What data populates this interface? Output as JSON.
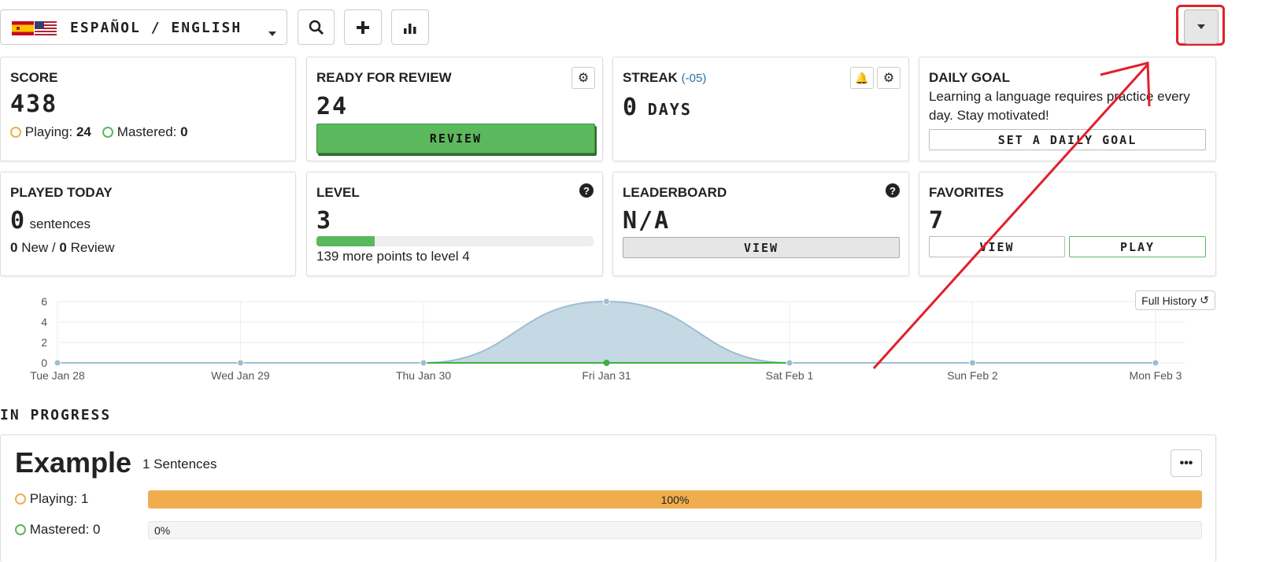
{
  "header": {
    "language_label": "ESPAÑOL / ENGLISH"
  },
  "score": {
    "title": "SCORE",
    "value": "438",
    "playing_label": "Playing:",
    "playing_value": "24",
    "mastered_label": "Mastered:",
    "mastered_value": "0"
  },
  "review": {
    "title": "READY FOR REVIEW",
    "value": "24",
    "button": "REVIEW"
  },
  "streak": {
    "title": "STREAK",
    "tz": "(-05)",
    "value": "0",
    "unit": "DAYS"
  },
  "daily_goal": {
    "title": "DAILY GOAL",
    "text": "Learning a language requires practice every day. Stay motivated!",
    "button": "SET A DAILY GOAL"
  },
  "played_today": {
    "title": "PLAYED TODAY",
    "value": "0",
    "unit": "sentences",
    "new_value": "0",
    "new_label": "New /",
    "review_value": "0",
    "review_label": "Review"
  },
  "level": {
    "title": "LEVEL",
    "value": "3",
    "progress": 0.21,
    "caption": "139 more points to level 4"
  },
  "leaderboard": {
    "title": "LEADERBOARD",
    "value": "N/A",
    "button": "VIEW"
  },
  "favorites": {
    "title": "FAVORITES",
    "value": "7",
    "view_button": "VIEW",
    "play_button": "PLAY"
  },
  "history": {
    "button": "Full History"
  },
  "chart_data": {
    "type": "area",
    "categories": [
      "Tue Jan 28",
      "Wed Jan 29",
      "Thu Jan 30",
      "Fri Jan 31",
      "Sat Feb 1",
      "Sun Feb 2",
      "Mon Feb 3"
    ],
    "series": [
      {
        "values": [
          0,
          0,
          0,
          6,
          0,
          0,
          0
        ],
        "color": "#9dbdd0"
      },
      {
        "values": [
          0,
          0,
          0,
          0,
          0,
          0,
          0
        ],
        "color": "#3cb043"
      }
    ],
    "yticks": [
      0,
      2,
      4,
      6
    ],
    "ylim": [
      0,
      6
    ]
  },
  "in_progress": {
    "heading": "IN PROGRESS",
    "name": "Example",
    "count": "1 Sentences",
    "playing_label": "Playing: 1",
    "playing_pct": "100%",
    "mastered_label": "Mastered: 0",
    "mastered_pct": "0%"
  },
  "colors": {
    "green": "#5cb85c",
    "orange": "#f0ad4e",
    "annotation": "#e0202a"
  }
}
